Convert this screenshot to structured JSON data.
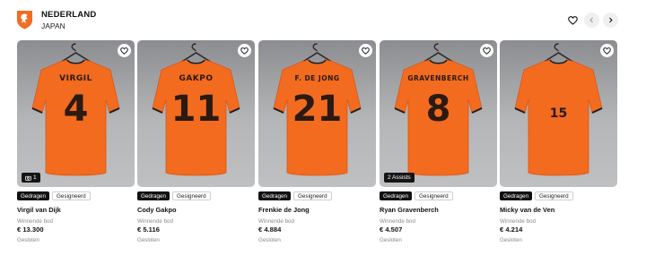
{
  "header": {
    "title": "NEDERLAND",
    "subtitle": "JAPAN",
    "brand_color": "#f36c21"
  },
  "icons": {
    "favorite": "heart-icon",
    "prev": "chevron-left-icon",
    "next": "chevron-right-icon",
    "logo": "lion-crest-icon"
  },
  "cards": [
    {
      "name": "Virgil van Dijk",
      "shirt_name": "VIRGIL",
      "number": "4",
      "tags": [
        "Gedragen",
        "Gesigneerd"
      ],
      "bid_label": "Winnende bod",
      "price": "€ 13.300",
      "status": "Gesloten",
      "badge": "1",
      "badge_icon": "camera-icon"
    },
    {
      "name": "Cody Gakpo",
      "shirt_name": "GAKPO",
      "number": "11",
      "tags": [
        "Gedragen",
        "Gesigneerd"
      ],
      "bid_label": "Winnende bod",
      "price": "€ 5.116",
      "status": "Gesloten",
      "badge": "",
      "badge_icon": ""
    },
    {
      "name": "Frenkie de Jong",
      "shirt_name": "F. DE JONG",
      "number": "21",
      "tags": [
        "Gedragen",
        "Gesigneerd"
      ],
      "bid_label": "Winnende bod",
      "price": "€ 4.884",
      "status": "Gesloten",
      "badge": "",
      "badge_icon": ""
    },
    {
      "name": "Ryan Gravenberch",
      "shirt_name": "GRAVENBERCH",
      "number": "8",
      "tags": [
        "Gedragen",
        "Gesigneerd"
      ],
      "bid_label": "Winnende bod",
      "price": "€ 4.507",
      "status": "Gesloten",
      "badge": "2 Assists",
      "badge_icon": ""
    },
    {
      "name": "Micky van de Ven",
      "shirt_name": "",
      "number": "15",
      "tags": [
        "Gedragen",
        "Gesigneerd"
      ],
      "bid_label": "Winnende bod",
      "price": "€ 4.214",
      "status": "Gesloten",
      "badge": "",
      "badge_icon": ""
    }
  ],
  "colors": {
    "jersey": "#f26b1f",
    "jersey_shadow": "#d9571a",
    "tag_dark": "#111111"
  }
}
